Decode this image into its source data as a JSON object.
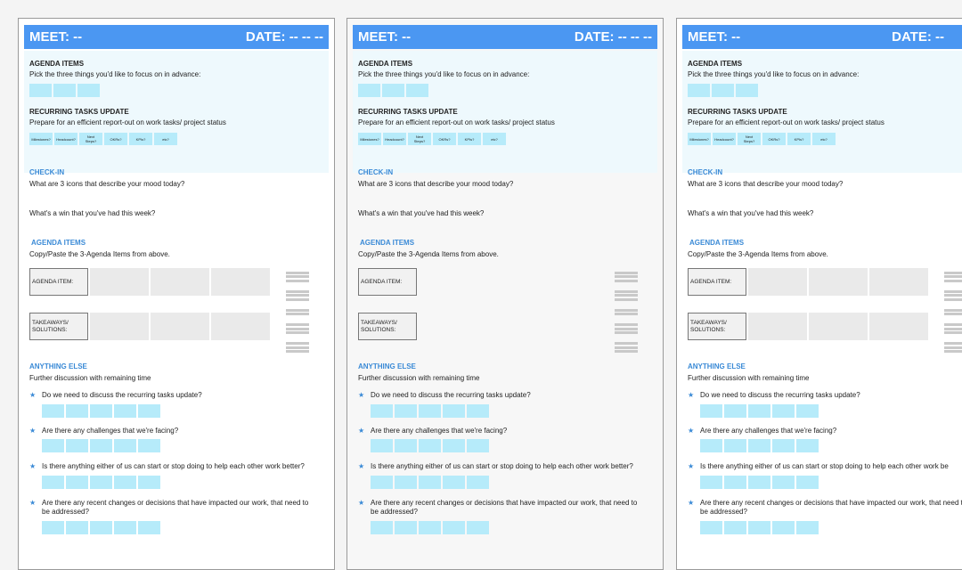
{
  "pages": [
    {
      "meet": "MEET: --",
      "date": "DATE: -- -- --",
      "agenda_title": "AGENDA ITEMS",
      "agenda_desc": "Pick the three things you'd like to focus on in advance:",
      "recurring_title": "RECURRING TASKS UPDATE",
      "recurring_desc": "Prepare for an efficient report-out on work tasks/ project status",
      "tags": [
        "Milestones?",
        "Headcount?",
        "Next Steps?",
        "OKRs?",
        "KPIs?",
        "etc?"
      ],
      "checkin_title": "CHECK-IN",
      "checkin_q1": "What are 3 icons that describe your mood today?",
      "checkin_q2": "What's a win that you've had this week?",
      "agenda2_title": "AGENDA ITEMS",
      "agenda2_desc": "Copy/Paste the 3-Agenda Items from above.",
      "agenda_item_label": "AGENDA ITEM:",
      "takeaways_label": "TAKEAWAYS/ SOLUTIONS:",
      "else_title": "ANYTHING ELSE",
      "else_desc": "Further discussion with remaining time",
      "star": "★",
      "questions": [
        "Do we need to discuss the recurring tasks update?",
        "Are there any challenges that we're facing?",
        "Is there anything either of us can start or stop doing to help each other work better?",
        "Are there any recent changes or decisions that have impacted our work, that need to be addressed?"
      ]
    },
    {
      "meet": "MEET: --",
      "date": "DATE: -- -- --",
      "agenda_title": "AGENDA ITEMS",
      "agenda_desc": "Pick the three things you'd like to focus on in advance:",
      "recurring_title": "RECURRING TASKS UPDATE",
      "recurring_desc": "Prepare for an efficient report-out on work tasks/ project status",
      "tags": [
        "Milestones?",
        "Headcount?",
        "Next Steps?",
        "OKRs?",
        "KPIs?",
        "etc?"
      ],
      "checkin_title": "CHECK-IN",
      "checkin_q1": "What are 3 icons that describe your mood today?",
      "checkin_q2": "What's a win that you've had this week?",
      "agenda2_title": "AGENDA ITEMS",
      "agenda2_desc": "Copy/Paste the 3-Agenda Items from above.",
      "agenda_item_label": "AGENDA ITEM:",
      "takeaways_label": "TAKEAWAYS/ SOLUTIONS:",
      "else_title": "ANYTHING ELSE",
      "else_desc": "Further discussion with remaining time",
      "star": "★",
      "questions": [
        "Do we need to discuss the recurring tasks update?",
        "Are there any challenges that we're facing?",
        "Is there anything either of us can start or stop doing to help each other work better?",
        "Are there any recent changes or decisions that have impacted our work, that need to be addressed?"
      ]
    },
    {
      "meet": "MEET: --",
      "date": "DATE: --",
      "agenda_title": "AGENDA ITEMS",
      "agenda_desc": "Pick the three things you'd like to focus on in advance:",
      "recurring_title": "RECURRING TASKS UPDATE",
      "recurring_desc": "Prepare for an efficient report-out on work tasks/ project status",
      "tags": [
        "Milestones?",
        "Headcount?",
        "Next Steps?",
        "OKRs?",
        "KPIs?",
        "etc?"
      ],
      "checkin_title": "CHECK-IN",
      "checkin_q1": "What are 3 icons that describe your mood today?",
      "checkin_q2": "What's a win that you've had this week?",
      "agenda2_title": "AGENDA ITEMS",
      "agenda2_desc": "Copy/Paste the 3-Agenda Items from above.",
      "agenda_item_label": "AGENDA ITEM:",
      "takeaways_label": "TAKEAWAYS/ SOLUTIONS:",
      "else_title": "ANYTHING ELSE",
      "else_desc": "Further discussion with remaining time",
      "star": "★",
      "questions": [
        "Do we need to discuss the recurring tasks update?",
        "Are there any challenges that we're facing?",
        "Is there anything either of us can start or stop doing to help each other work be",
        "Are there any recent changes or decisions that have impacted our work, that need to be addressed?"
      ]
    }
  ]
}
